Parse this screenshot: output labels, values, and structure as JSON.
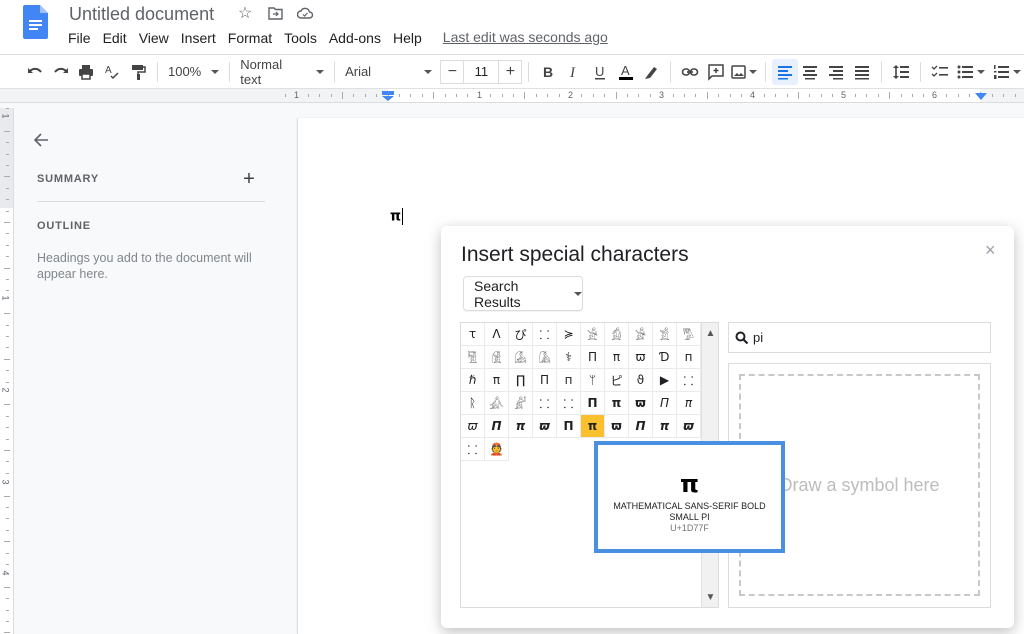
{
  "app": {
    "doc_title": "Untitled document",
    "title_icons": [
      "star-icon",
      "move-to-folder-icon",
      "cloud-status-icon"
    ],
    "menu": [
      "File",
      "Edit",
      "View",
      "Insert",
      "Format",
      "Tools",
      "Add-ons",
      "Help"
    ],
    "last_edit": "Last edit was seconds ago"
  },
  "toolbar": {
    "zoom": "100%",
    "style": "Normal text",
    "font": "Arial",
    "font_size": "11",
    "minus": "−",
    "plus": "+",
    "text_color": "#000000",
    "accent_color": "#1a73e8"
  },
  "ruler": {
    "horizontal_labels": [
      "1",
      "1",
      "2",
      "3",
      "4",
      "5",
      "6"
    ],
    "vertical_labels": [
      "1",
      "1",
      "2",
      "3",
      "4"
    ]
  },
  "outline": {
    "summary_label": "SUMMARY",
    "summary_add": "+",
    "outline_label": "OUTLINE",
    "hint": "Headings you add to the document will appear here."
  },
  "document": {
    "content": "π"
  },
  "dialog": {
    "title": "Insert special characters",
    "close": "×",
    "category": "Search Results",
    "search_query": "pi",
    "draw_placeholder": "Draw a symbol here",
    "characters": [
      {
        "ch": "ꚍ"
      },
      {
        "ch": "Λ"
      },
      {
        "ch": "ぴ"
      },
      {
        "ch": "⸬"
      },
      {
        "ch": "≽"
      },
      {
        "ch": "𓀀"
      },
      {
        "ch": "𓀁"
      },
      {
        "ch": "𓀂"
      },
      {
        "ch": "𓀃"
      },
      {
        "ch": "𓀄"
      },
      {
        "ch": "𓀅"
      },
      {
        "ch": "𓀆"
      },
      {
        "ch": "𓀇"
      },
      {
        "ch": "𓀈"
      },
      {
        "ch": "⚕"
      },
      {
        "ch": "Π"
      },
      {
        "ch": "π"
      },
      {
        "ch": "ϖ"
      },
      {
        "ch": "Ɗ"
      },
      {
        "ch": "п"
      },
      {
        "ch": "ℏ"
      },
      {
        "ch": "π"
      },
      {
        "ch": "∏"
      },
      {
        "ch": "Π"
      },
      {
        "ch": "п"
      },
      {
        "ch": "ᛘ"
      },
      {
        "ch": "ピ"
      },
      {
        "ch": "ϑ"
      },
      {
        "ch": "▶"
      },
      {
        "ch": "⸬"
      },
      {
        "ch": "ᚱ"
      },
      {
        "ch": "𓀉"
      },
      {
        "ch": "𓀊"
      },
      {
        "ch": "⸬"
      },
      {
        "ch": "⸬"
      },
      {
        "ch": "Π",
        "style": "bold"
      },
      {
        "ch": "π",
        "style": "bold"
      },
      {
        "ch": "ϖ",
        "style": "bold"
      },
      {
        "ch": "Π",
        "style": "ital"
      },
      {
        "ch": "π",
        "style": "ital"
      },
      {
        "ch": "ϖ",
        "style": "ital"
      },
      {
        "ch": "Π",
        "style": "bold ital"
      },
      {
        "ch": "π",
        "style": "bold ital"
      },
      {
        "ch": "ϖ",
        "style": "bold ital"
      },
      {
        "ch": "Π",
        "style": "bold"
      },
      {
        "ch": "π",
        "style": "bold",
        "selected": true
      },
      {
        "ch": "ϖ",
        "style": "bold"
      },
      {
        "ch": "Π",
        "style": "bold ital"
      },
      {
        "ch": "π",
        "style": "bold ital"
      },
      {
        "ch": "ϖ",
        "style": "bold ital"
      },
      {
        "ch": "⸬"
      },
      {
        "ch": "👲"
      }
    ],
    "tooltip": {
      "glyph": "π",
      "name": "MATHEMATICAL SANS-SERIF BOLD SMALL PI",
      "code": "U+1D77F"
    }
  }
}
